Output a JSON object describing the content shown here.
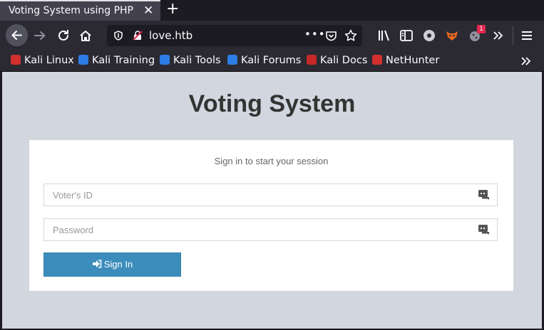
{
  "browser": {
    "tab_title": "Voting System using PHP",
    "url": "love.htb",
    "extension_badge": "1",
    "bookmarks": [
      {
        "label": "Kali Linux",
        "color": "#d32f2f"
      },
      {
        "label": "Kali Training",
        "color": "#2d7de6"
      },
      {
        "label": "Kali Tools",
        "color": "#2d7de6"
      },
      {
        "label": "Kali Forums",
        "color": "#2d7de6"
      },
      {
        "label": "Kali Docs",
        "color": "#c62828"
      },
      {
        "label": "NetHunter",
        "color": "#d32f2f"
      }
    ]
  },
  "page": {
    "title": "Voting System",
    "login_message": "Sign in to start your session",
    "voter_id_placeholder": "Voter's ID",
    "password_placeholder": "Password",
    "sign_in_label": "Sign In"
  },
  "colors": {
    "page_background": "#d2d6de",
    "button": "#3c8dbc",
    "browser_chrome": "#2b2a33"
  }
}
